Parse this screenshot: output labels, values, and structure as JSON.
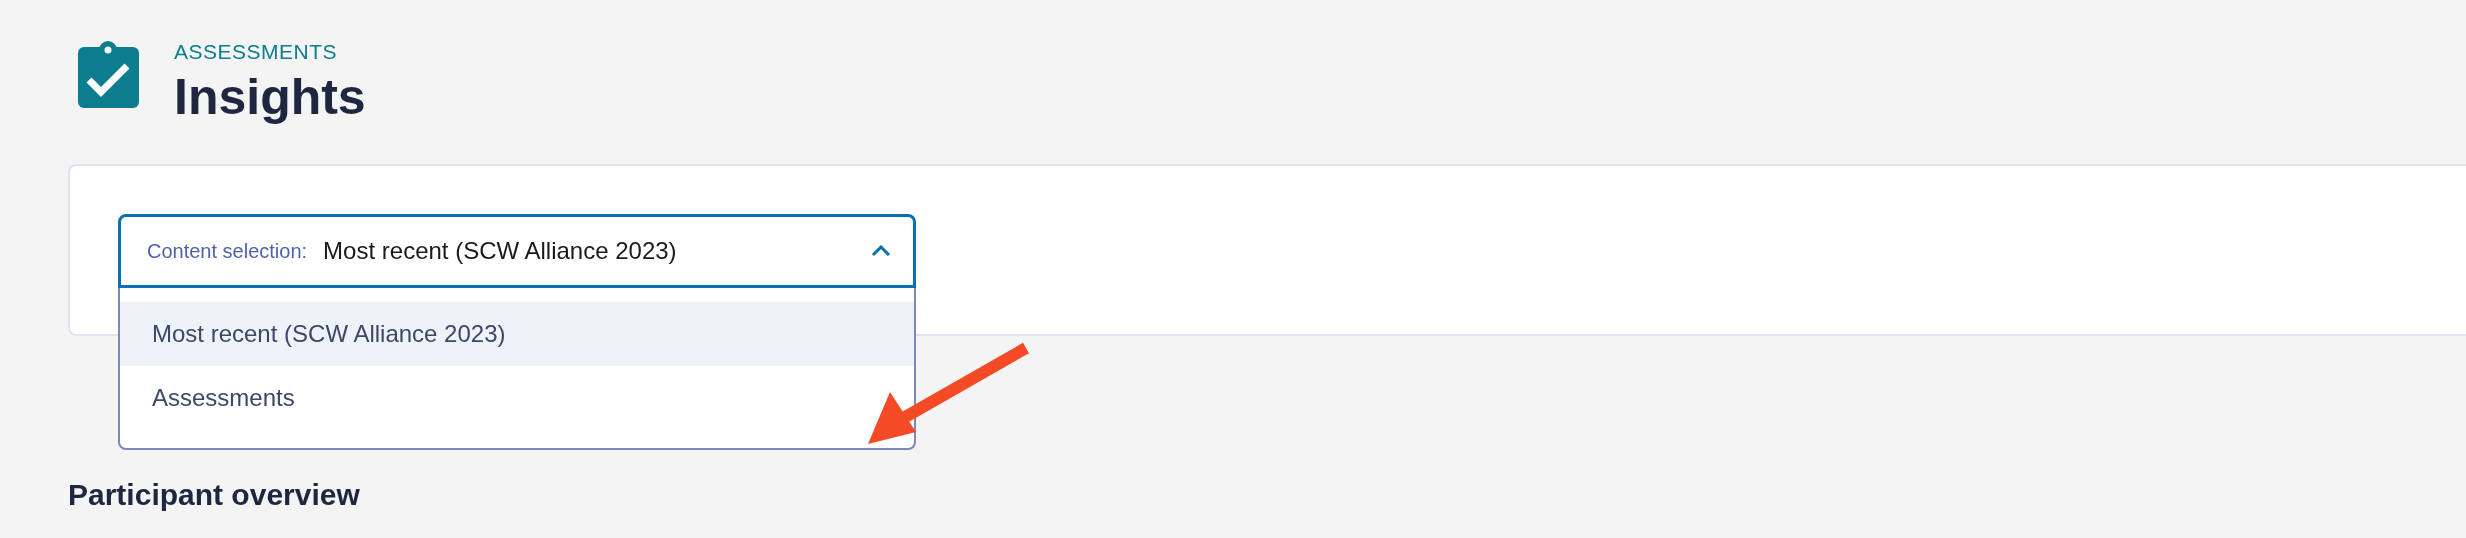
{
  "header": {
    "eyebrow": "ASSESSMENTS",
    "title": "Insights"
  },
  "content_selector": {
    "label": "Content selection:",
    "value": "Most recent (SCW Alliance 2023)",
    "expanded": true,
    "options": [
      {
        "label": "Most recent (SCW Alliance 2023)",
        "selected": true
      },
      {
        "label": "Assessments",
        "selected": false
      }
    ]
  },
  "section_title": "Participant overview"
}
